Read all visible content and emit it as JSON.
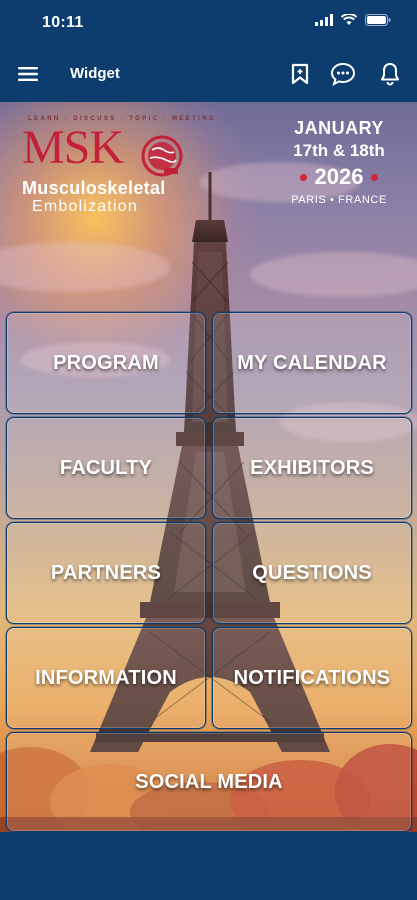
{
  "status_bar": {
    "time": "10:11"
  },
  "nav": {
    "title": "Widget",
    "icons": [
      "menu-icon",
      "bookmark-icon",
      "chat-icon",
      "bell-icon"
    ]
  },
  "banner": {
    "logo_tagline": "LEARN · DISCUSS · TOPIC · MEETING",
    "logo_acronym": "MSK",
    "logo_line1": "Musculoskeletal",
    "logo_line2": "Embolization",
    "month": "JANUARY",
    "days": "17th & 18th",
    "year": "2026",
    "place": "PARIS • FRANCE"
  },
  "tiles": [
    {
      "label": "PROGRAM"
    },
    {
      "label": "MY CALENDAR"
    },
    {
      "label": "FACULTY"
    },
    {
      "label": "EXHIBITORS"
    },
    {
      "label": "PARTNERS"
    },
    {
      "label": "QUESTIONS"
    },
    {
      "label": "INFORMATION"
    },
    {
      "label": "NOTIFICATIONS"
    },
    {
      "label": "SOCIAL MEDIA"
    }
  ],
  "colors": {
    "background": "#0d3c6e",
    "accent_red": "#c3213a"
  }
}
